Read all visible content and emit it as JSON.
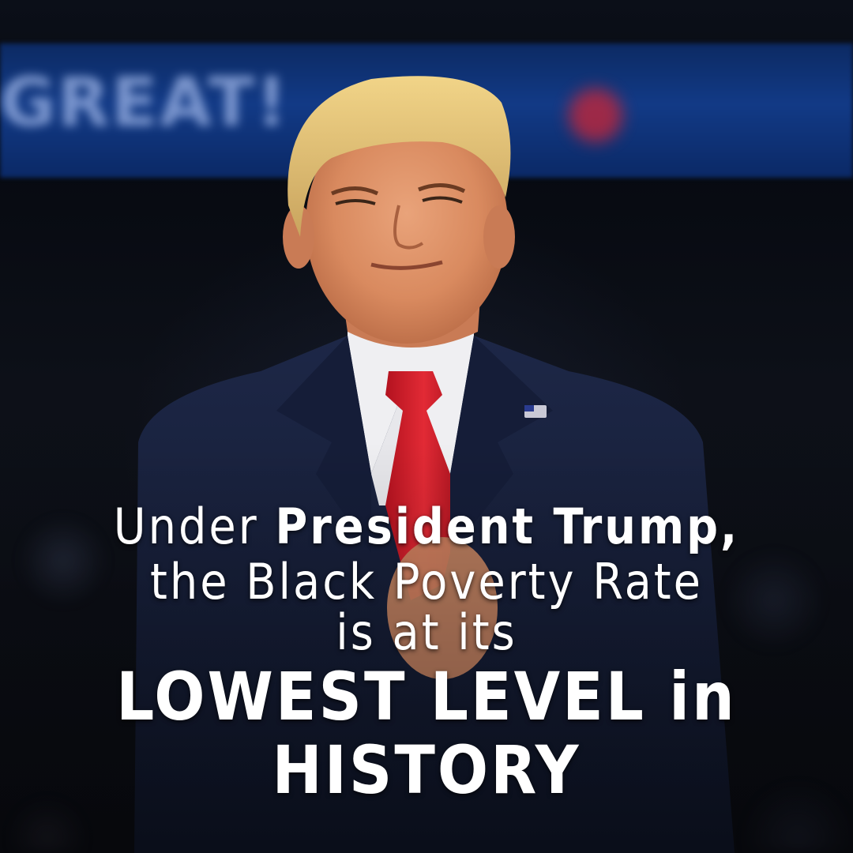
{
  "background": {
    "banner_text": "GREAT!",
    "banner_color": "#123a86",
    "accent_light_color": "#c0263a"
  },
  "headline": {
    "line1_prefix": "Under",
    "line1_emphasis": "President Trump,",
    "line2": "the Black Poverty Rate",
    "line3": "is at its",
    "line4": "LOWEST LEVEL in",
    "line5": "HISTORY",
    "text_color": "#ffffff"
  }
}
